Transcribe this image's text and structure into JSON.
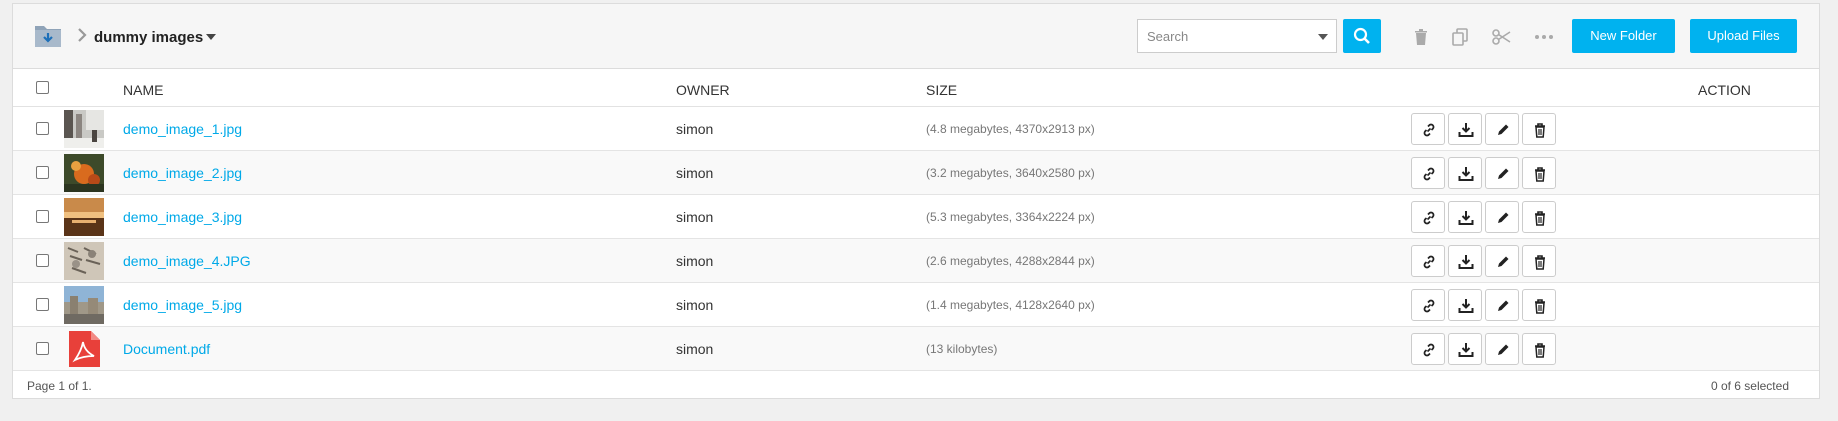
{
  "breadcrumb": {
    "folder_icon": "folder-download-icon",
    "label": "dummy images"
  },
  "search": {
    "placeholder": "Search"
  },
  "toolbar": {
    "new_folder": "New Folder",
    "upload_files": "Upload Files",
    "accent_color": "#00b2ef"
  },
  "table": {
    "columns": {
      "name": "NAME",
      "owner": "OWNER",
      "size": "SIZE",
      "action": "ACTION"
    },
    "rows": [
      {
        "name": "demo_image_1.jpg",
        "owner": "simon",
        "size": "(4.8 megabytes, 4370x2913 px)"
      },
      {
        "name": "demo_image_2.jpg",
        "owner": "simon",
        "size": "(3.2 megabytes, 3640x2580 px)"
      },
      {
        "name": "demo_image_3.jpg",
        "owner": "simon",
        "size": "(5.3 megabytes, 3364x2224 px)"
      },
      {
        "name": "demo_image_4.JPG",
        "owner": "simon",
        "size": "(2.6 megabytes, 4288x2844 px)"
      },
      {
        "name": "demo_image_5.jpg",
        "owner": "simon",
        "size": "(1.4 megabytes, 4128x2640 px)"
      },
      {
        "name": "Document.pdf",
        "owner": "simon",
        "size": "(13 kilobytes)"
      }
    ]
  },
  "footer": {
    "page_info": "Page 1 of 1.",
    "selection": "0 of 6 selected"
  }
}
